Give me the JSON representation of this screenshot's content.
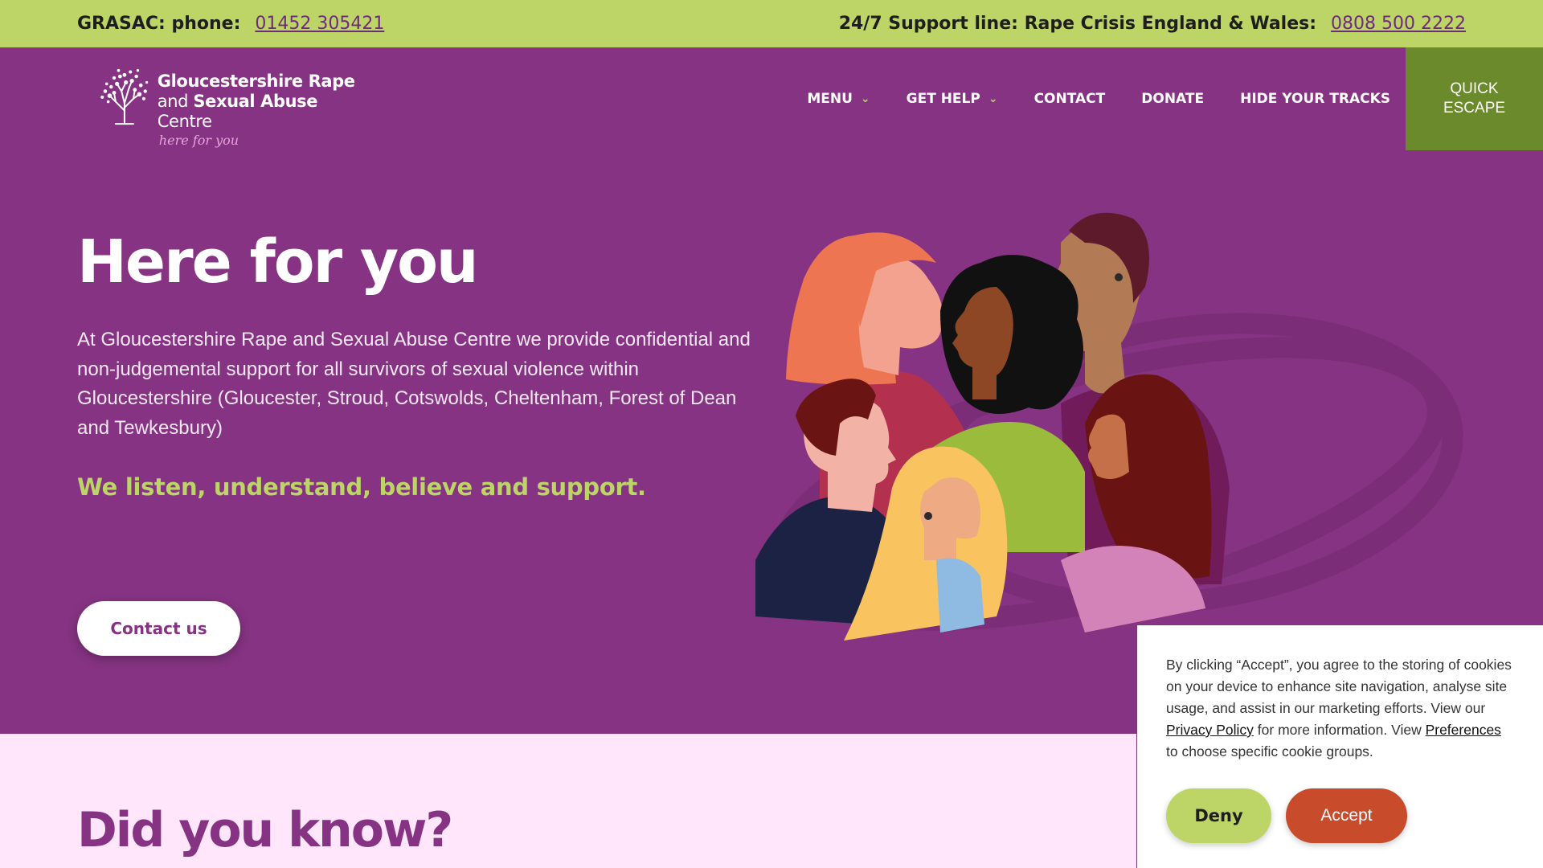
{
  "topbar": {
    "left_label": "GRASAC: phone:",
    "left_phone": "01452 305421",
    "right_label": "24/7 Support line: Rape Crisis England & Wales:",
    "right_phone": "0808 500 2222"
  },
  "logo": {
    "line1": "Gloucestershire Rape",
    "line2_a": "and ",
    "line2_b": "Sexual Abuse",
    "line2_c": " Centre",
    "tagline": "here for you",
    "icon": "tree-icon"
  },
  "nav": {
    "menu": "MENU",
    "get_help": "GET HELP",
    "contact": "CONTACT",
    "donate": "DONATE",
    "hide_tracks": "HIDE YOUR TRACKS",
    "quick_escape_1": "QUICK",
    "quick_escape_2": "ESCAPE"
  },
  "hero": {
    "title": "Here for you",
    "text": "At Gloucestershire Rape and Sexual Abuse Centre we provide confidential and non-judgemental support for all survivors of sexual violence within Gloucestershire (Gloucester, Stroud, Cotswolds, Cheltenham, Forest of Dean and Tewkesbury)",
    "tagline": "We listen, understand, believe and support.",
    "contact_button": "Contact us",
    "illustration": "group-of-people-illustration"
  },
  "dyk": {
    "title": "Did you know?"
  },
  "cookie": {
    "text_1": "By clicking “Accept”, you agree to the storing of cookies on your device to enhance site navigation, analyse site usage, and assist in our marketing efforts. View our ",
    "privacy_link": "Privacy Policy",
    "text_2": " for more information. View ",
    "preferences_link": "Preferences",
    "text_3": " to choose specific cookie groups.",
    "deny": "Deny",
    "accept": "Accept"
  },
  "colors": {
    "lime": "#bdd567",
    "purple": "#853382",
    "escape_green": "#6b8a2b",
    "accept_red": "#c84c2c",
    "pink_bg": "#ffe6fa"
  }
}
